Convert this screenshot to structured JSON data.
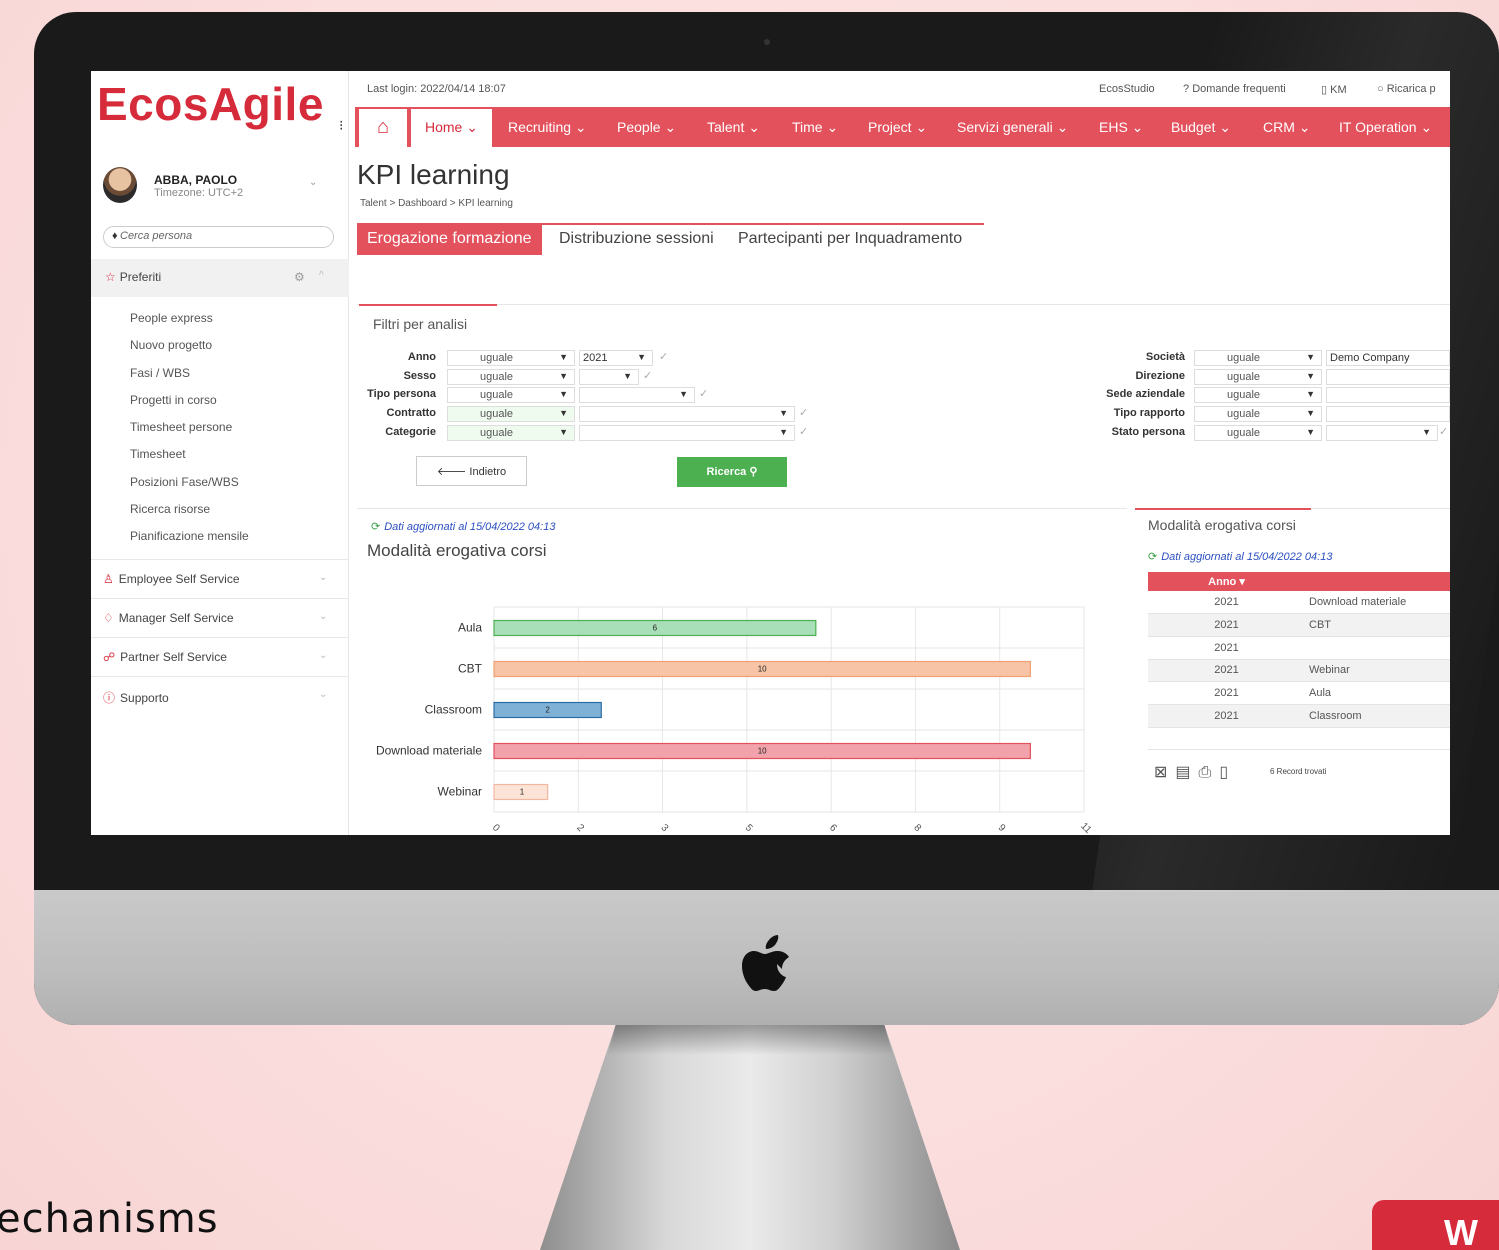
{
  "app": {
    "logo": "EcosAgile"
  },
  "user": {
    "name": "ABBA, PAOLO",
    "timezone": "Timezone: UTC+2"
  },
  "sidebar": {
    "search_placeholder": "Cerca persona",
    "favorites_label": "Preferiti",
    "favorites": [
      "People express",
      "Nuovo progetto",
      "Fasi / WBS",
      "Progetti in corso",
      "Timesheet persone",
      "Timesheet",
      "Posizioni Fase/WBS",
      "Ricerca risorse",
      "Pianificazione mensile"
    ],
    "sections": [
      "Employee Self Service",
      "Manager Self Service",
      "Partner Self Service",
      "Supporto"
    ]
  },
  "topbar": {
    "last_login": "Last login: 2022/04/14 18:07",
    "links": [
      "EcosStudio",
      "Domande frequenti",
      "KM",
      "Ricarica p"
    ]
  },
  "nav": {
    "items": [
      "Home",
      "Recruiting",
      "People",
      "Talent",
      "Time",
      "Project",
      "Servizi generali",
      "EHS",
      "Budget",
      "CRM",
      "IT Operation"
    ]
  },
  "page": {
    "title": "KPI learning",
    "breadcrumb": "Talent > Dashboard > KPI learning"
  },
  "tabs": [
    "Erogazione formazione",
    "Distribuzione sessioni",
    "Partecipanti per Inquadramento"
  ],
  "filters": {
    "title": "Filtri per analisi",
    "left": [
      {
        "label": "Anno",
        "op": "uguale",
        "value": "2021"
      },
      {
        "label": "Sesso",
        "op": "uguale",
        "value": ""
      },
      {
        "label": "Tipo persona",
        "op": "uguale",
        "value": ""
      },
      {
        "label": "Contratto",
        "op": "uguale",
        "value": ""
      },
      {
        "label": "Categorie",
        "op": "uguale",
        "value": ""
      }
    ],
    "right": [
      {
        "label": "Società",
        "op": "uguale",
        "value": "Demo Company"
      },
      {
        "label": "Direzione",
        "op": "uguale",
        "value": ""
      },
      {
        "label": "Sede aziendale",
        "op": "uguale",
        "value": ""
      },
      {
        "label": "Tipo rapporto",
        "op": "uguale",
        "value": ""
      },
      {
        "label": "Stato persona",
        "op": "uguale",
        "value": ""
      }
    ],
    "back_label": "Indietro",
    "search_label": "Ricerca"
  },
  "updated": "Dati aggiornati al 15/04/2022 04:13",
  "chart_data": {
    "type": "bar",
    "orientation": "horizontal",
    "title": "Modalità erogativa corsi",
    "categories": [
      "Aula",
      "CBT",
      "Classroom",
      "Download materiale",
      "Webinar"
    ],
    "values": [
      6,
      10,
      2,
      10,
      1
    ],
    "colors": [
      "#a8dfb8",
      "#f7c4a7",
      "#7fb0d6",
      "#f2a2aa",
      "#fde3d6"
    ],
    "border_colors": [
      "#4caf50",
      "#f0a070",
      "#2c6ea3",
      "#e3515c",
      "#f0b8a0"
    ],
    "xticks": [
      "0",
      "2",
      "3",
      "5",
      "6",
      "8",
      "9",
      "11"
    ],
    "xlim": [
      0,
      11
    ],
    "grid": true
  },
  "table_panel": {
    "title": "Modalità erogativa corsi",
    "header": "Anno",
    "rows": [
      {
        "anno": "2021",
        "mode": "Download materiale"
      },
      {
        "anno": "2021",
        "mode": "CBT"
      },
      {
        "anno": "2021",
        "mode": ""
      },
      {
        "anno": "2021",
        "mode": "Webinar"
      },
      {
        "anno": "2021",
        "mode": "Aula"
      },
      {
        "anno": "2021",
        "mode": "Classroom"
      },
      {
        "anno": "",
        "mode": ""
      }
    ],
    "record_count": "6 Record trovati"
  },
  "caption": "echanisms",
  "badge": "W"
}
